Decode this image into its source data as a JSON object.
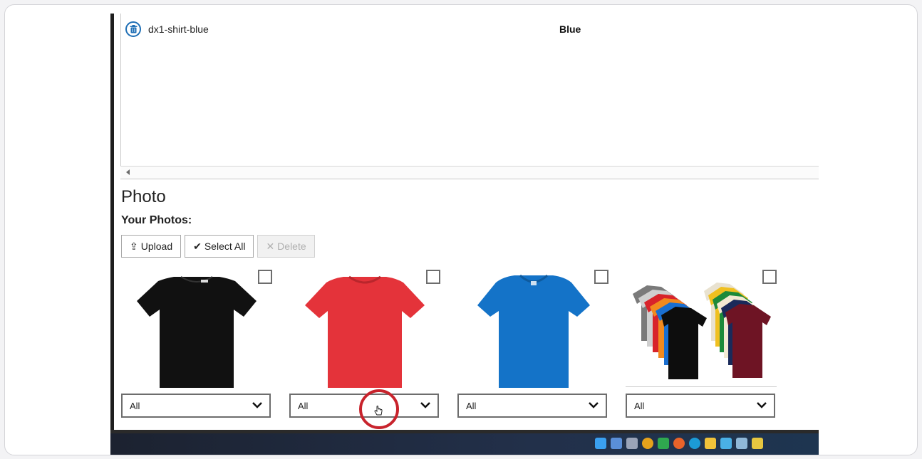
{
  "variants": [
    {
      "name": "dx1-shirt-blue",
      "color": "Blue",
      "delete_icon": "trash-icon"
    }
  ],
  "photo": {
    "title": "Photo",
    "subtitle": "Your Photos:",
    "toolbar": {
      "upload_label": "Upload",
      "select_all_label": "Select All",
      "delete_label": "Delete"
    },
    "photos": [
      {
        "name": "black t-shirt",
        "shirt_color": "#111111",
        "filter": "All",
        "checked": false
      },
      {
        "name": "red t-shirt",
        "shirt_color": "#e4333a",
        "filter": "All",
        "checked": false
      },
      {
        "name": "blue t-shirt",
        "shirt_color": "#1473c8",
        "filter": "All",
        "checked": false
      },
      {
        "name": "multicolor t-shirts",
        "shirt_color": "multi",
        "filter": "All",
        "checked": false
      }
    ]
  },
  "colors": {
    "accent": "#1f6fb5",
    "click_highlight": "#c8232c"
  },
  "taskbar_icons": [
    "windows-start-icon",
    "widgets-icon",
    "task-view-icon",
    "chrome-icon",
    "chat-icon",
    "firefox-icon",
    "edge-icon",
    "file-explorer-icon",
    "network-icon",
    "app-icon",
    "app-icon-2"
  ]
}
